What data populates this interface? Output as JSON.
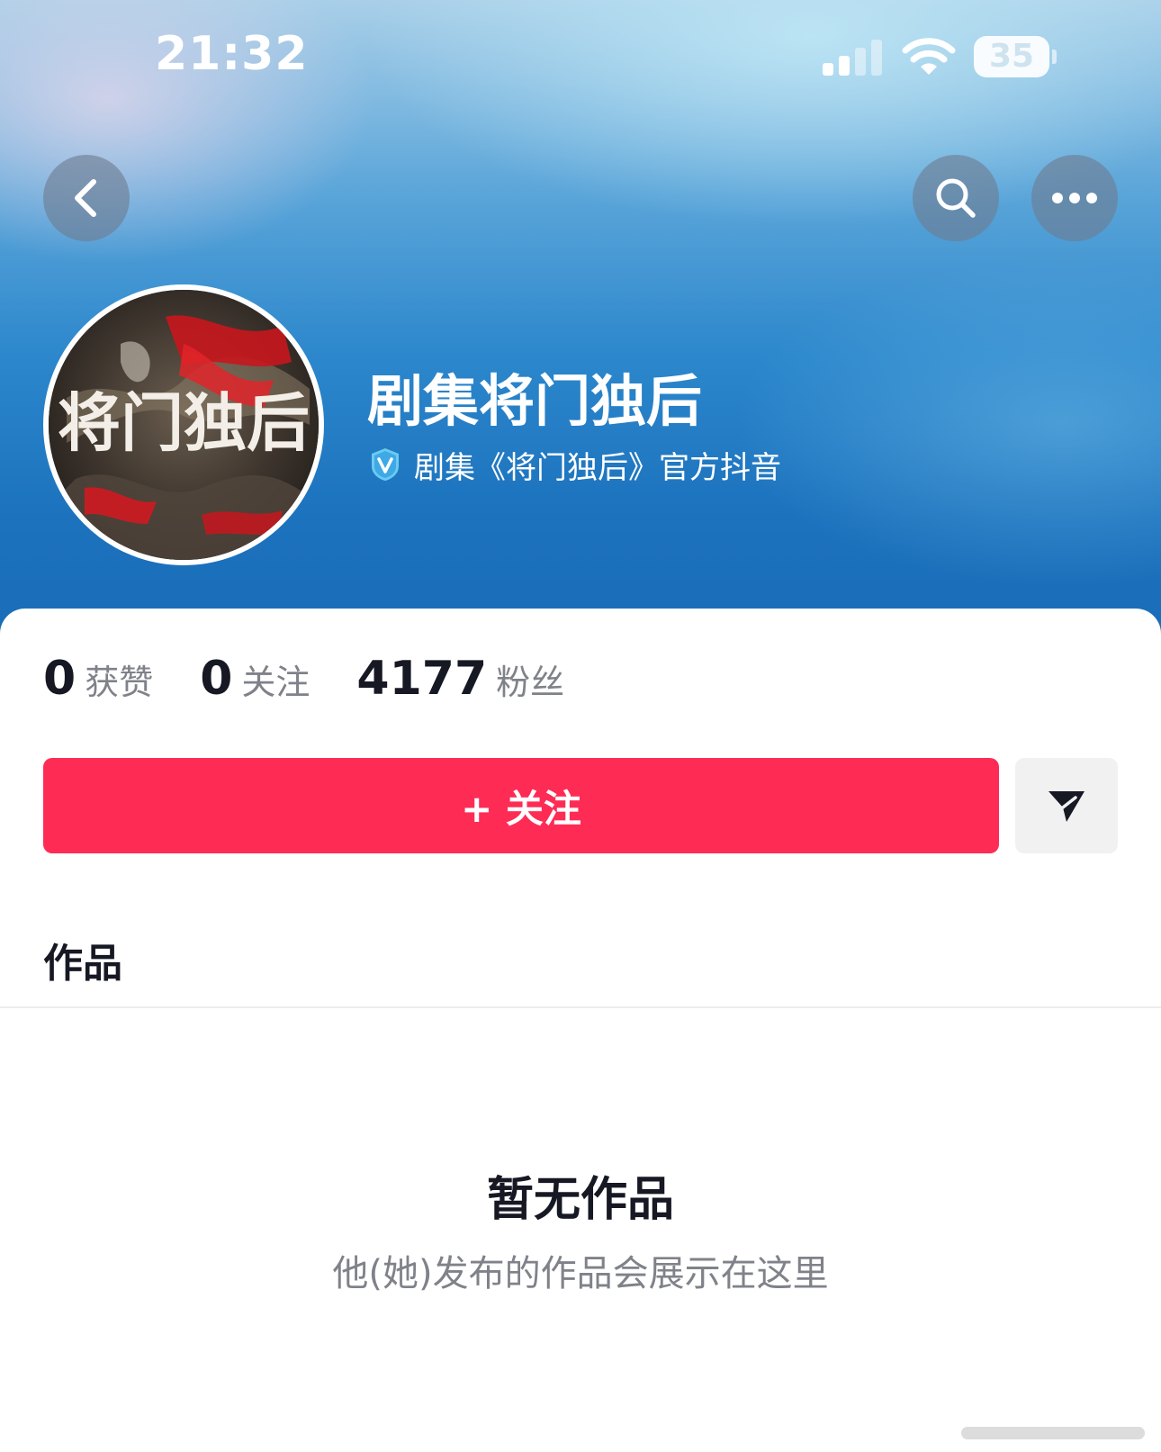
{
  "status_bar": {
    "time": "21:32",
    "battery": "35"
  },
  "nav": {
    "back_icon": "chevron-left-icon",
    "search_icon": "search-icon",
    "more_icon": "ellipsis-icon"
  },
  "profile": {
    "avatar_text": "将门独后",
    "name": "剧集将门独后",
    "verified_label": "剧集《将门独后》官方抖音",
    "verified_icon": "verified-v-icon"
  },
  "stats": [
    {
      "value": "0",
      "label": "获赞"
    },
    {
      "value": "0",
      "label": "关注"
    },
    {
      "value": "4177",
      "label": "粉丝"
    }
  ],
  "actions": {
    "follow_label": "+ 关注",
    "share_icon": "send-icon"
  },
  "tabs": {
    "works": "作品"
  },
  "empty_state": {
    "title": "暂无作品",
    "subtitle": "他(她)发布的作品会展示在这里"
  },
  "colors": {
    "accent": "#fe2c55",
    "text_primary": "#161823",
    "text_secondary": "#80828a"
  }
}
